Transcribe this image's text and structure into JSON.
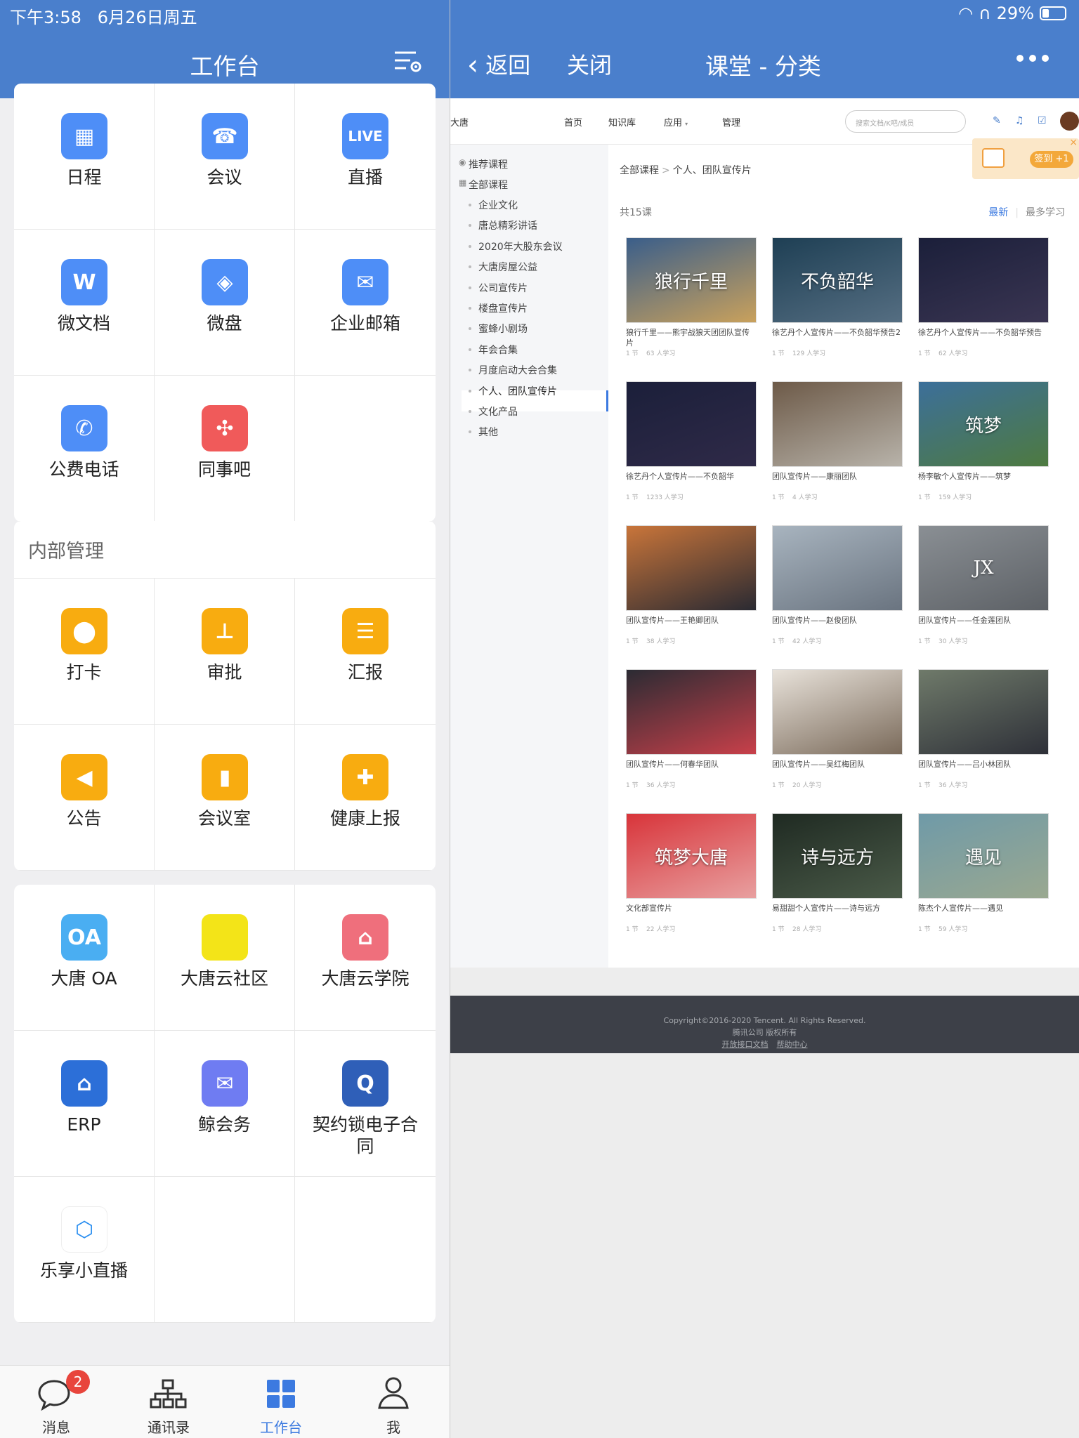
{
  "status": {
    "time": "下午3:58",
    "date": "6月26日周五",
    "battery": "29%"
  },
  "left": {
    "title": "工作台",
    "section1": {
      "items": [
        {
          "label": "日程",
          "icon": "calendar-icon",
          "color": "#4e8ef7",
          "glyph": "▦"
        },
        {
          "label": "会议",
          "icon": "meeting-cloud-icon",
          "color": "#4e8ef7",
          "glyph": "☎"
        },
        {
          "label": "直播",
          "icon": "live-icon",
          "color": "#4e8ef7",
          "glyph": "LIVE"
        },
        {
          "label": "微文档",
          "icon": "document-icon",
          "color": "#4e8ef7",
          "glyph": "W"
        },
        {
          "label": "微盘",
          "icon": "drive-icon",
          "color": "#4e8ef7",
          "glyph": "◈"
        },
        {
          "label": "企业邮箱",
          "icon": "mail-icon",
          "color": "#4e8ef7",
          "glyph": "✉"
        },
        {
          "label": "公费电话",
          "icon": "phone-icon",
          "color": "#4e8ef7",
          "glyph": "✆"
        },
        {
          "label": "同事吧",
          "icon": "colleague-icon",
          "color": "#f05a5a",
          "glyph": "✣"
        },
        {
          "label": "",
          "icon": "",
          "color": "",
          "glyph": ""
        }
      ]
    },
    "section2": {
      "title": "内部管理",
      "items": [
        {
          "label": "打卡",
          "icon": "location-icon",
          "color": "#f8ac10",
          "glyph": "⬤"
        },
        {
          "label": "审批",
          "icon": "stamp-icon",
          "color": "#f8ac10",
          "glyph": "⊥"
        },
        {
          "label": "汇报",
          "icon": "report-icon",
          "color": "#f8ac10",
          "glyph": "☰"
        },
        {
          "label": "公告",
          "icon": "megaphone-icon",
          "color": "#f8ac10",
          "glyph": "◀"
        },
        {
          "label": "会议室",
          "icon": "door-icon",
          "color": "#f8ac10",
          "glyph": "▮"
        },
        {
          "label": "健康上报",
          "icon": "health-report-icon",
          "color": "#f8ac10",
          "glyph": "✚"
        }
      ]
    },
    "section3": {
      "items": [
        {
          "label": "大唐 OA",
          "icon": "oa-icon",
          "color": "#4aaef2",
          "glyph": "OA"
        },
        {
          "label": "大唐云社区",
          "icon": "community-icon",
          "color": "#f3e418",
          "glyph": ""
        },
        {
          "label": "大唐云学院",
          "icon": "academy-icon",
          "color": "#ef6f7c",
          "glyph": "⌂"
        },
        {
          "label": "ERP",
          "icon": "erp-icon",
          "color": "#2c6fd8",
          "glyph": "⌂"
        },
        {
          "label": "鲸会务",
          "icon": "whale-meeting-icon",
          "color": "#6f7cf2",
          "glyph": "✉"
        },
        {
          "label": "契约锁电子合同",
          "icon": "contract-lock-icon",
          "color": "#2f5fb8",
          "glyph": "Q"
        },
        {
          "label": "乐享小直播",
          "icon": "lexiang-live-icon",
          "color": "#ffffff",
          "glyph": "⬡"
        },
        {
          "label": "",
          "icon": "",
          "color": "",
          "glyph": ""
        },
        {
          "label": "",
          "icon": "",
          "color": "",
          "glyph": ""
        }
      ]
    },
    "tabs": [
      {
        "label": "消息",
        "icon": "chat-bubble-icon",
        "badge": "2"
      },
      {
        "label": "通讯录",
        "icon": "org-chart-icon",
        "badge": ""
      },
      {
        "label": "工作台",
        "icon": "grid-icon",
        "badge": ""
      },
      {
        "label": "我",
        "icon": "person-icon",
        "badge": ""
      }
    ]
  },
  "right": {
    "back_label": "返回",
    "close_label": "关闭",
    "title": "课堂 - 分类",
    "web": {
      "brand": "大唐",
      "nav": [
        "首页",
        "知识库",
        "应用",
        "管理"
      ],
      "search_placeholder": "搜索文档/K吧/成员",
      "checkin_label": "签到 +1",
      "sidebar": {
        "top": [
          "推荐课程",
          "全部课程"
        ],
        "items": [
          "企业文化",
          "唐总精彩讲话",
          "2020年大股东会议",
          "大唐房屋公益",
          "公司宣传片",
          "楼盘宣传片",
          "蜜蜂小剧场",
          "年会合集",
          "月度启动大会合集",
          "个人、团队宣传片",
          "文化产品",
          "其他"
        ],
        "selected": "个人、团队宣传片"
      },
      "breadcrumb": [
        "全部课程",
        "个人、团队宣传片"
      ],
      "count": "共15课",
      "sort": [
        "最新",
        "最多学习"
      ],
      "courses": [
        {
          "title": "狼行千里——熊宇战狼天团团队宣传片",
          "lessons": "1 节",
          "learners": "63 人学习",
          "caption": "狼行千里",
          "c1": "#3a5e8a",
          "c2": "#c9a15c"
        },
        {
          "title": "徐艺丹个人宣传片——不负韶华预告2",
          "lessons": "1 节",
          "learners": "129 人学习",
          "caption": "不负韶华",
          "c1": "#1e3f54",
          "c2": "#556e82"
        },
        {
          "title": "徐艺丹个人宣传片——不负韶华预告",
          "lessons": "1 节",
          "learners": "62 人学习",
          "caption": "",
          "c1": "#1b1f3a",
          "c2": "#3a3552"
        },
        {
          "title": "徐艺丹个人宣传片——不负韶华",
          "lessons": "1 节",
          "learners": "1233 人学习",
          "caption": "",
          "c1": "#1b1f3a",
          "c2": "#2f2a48"
        },
        {
          "title": "团队宣传片——康丽团队",
          "lessons": "1 节",
          "learners": "4 人学习",
          "caption": "",
          "c1": "#6d5a48",
          "c2": "#b8b3aa"
        },
        {
          "title": "杨李敏个人宣传片——筑梦",
          "lessons": "1 节",
          "learners": "159 人学习",
          "caption": "筑梦",
          "c1": "#3c6f9a",
          "c2": "#4e7a40"
        },
        {
          "title": "团队宣传片——王艳卿团队",
          "lessons": "1 节",
          "learners": "38 人学习",
          "caption": "",
          "c1": "#c9753a",
          "c2": "#2a2a32"
        },
        {
          "title": "团队宣传片——赵俊团队",
          "lessons": "1 节",
          "learners": "42 人学习",
          "caption": "",
          "c1": "#a8b4bf",
          "c2": "#6a7480"
        },
        {
          "title": "团队宣传片——任金莲团队",
          "lessons": "1 节",
          "learners": "30 人学习",
          "caption": "JX",
          "c1": "#8a8f94",
          "c2": "#5d6166"
        },
        {
          "title": "团队宣传片——何春华团队",
          "lessons": "1 节",
          "learners": "36 人学习",
          "caption": "",
          "c1": "#2b2b33",
          "c2": "#c8404a"
        },
        {
          "title": "团队宣传片——吴红梅团队",
          "lessons": "1 节",
          "learners": "20 人学习",
          "caption": "",
          "c1": "#e8e2da",
          "c2": "#7a6a5a"
        },
        {
          "title": "团队宣传片——吕小林团队",
          "lessons": "1 节",
          "learners": "36 人学习",
          "caption": "",
          "c1": "#6f7a6a",
          "c2": "#2e3038"
        },
        {
          "title": "文化部宣传片",
          "lessons": "1 节",
          "learners": "22 人学习",
          "caption": "筑梦大唐",
          "c1": "#d8343a",
          "c2": "#e8a0a0"
        },
        {
          "title": "易甜甜个人宣传片——诗与远方",
          "lessons": "1 节",
          "learners": "28 人学习",
          "caption": "诗与远方",
          "c1": "#1f2a22",
          "c2": "#4a5a48"
        },
        {
          "title": "陈杰个人宣传片——遇见",
          "lessons": "1 节",
          "learners": "59 人学习",
          "caption": "遇见",
          "c1": "#6f9aa8",
          "c2": "#9aa890"
        }
      ],
      "footer": {
        "copyright": "Copyright©2016-2020 Tencent. All Rights Reserved.",
        "company": "腾讯公司 版权所有",
        "links": [
          "开放接口文档",
          "帮助中心"
        ]
      }
    }
  }
}
